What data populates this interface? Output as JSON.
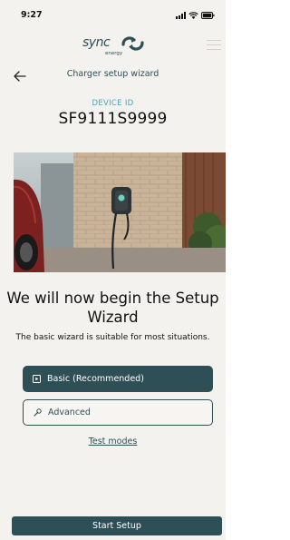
{
  "status_bar": {
    "time": "9:27",
    "icons": [
      "signal-icon",
      "wifi-icon",
      "battery-icon"
    ]
  },
  "brand": {
    "logo_text": "sync",
    "logo_subtext": "energy",
    "accent_color": "#2f4f57",
    "highlight_color": "#4aa3c8"
  },
  "header": {
    "title": "Charger setup wizard",
    "back_icon": "arrow-left-icon",
    "menu_icon": "hamburger-menu-icon"
  },
  "device": {
    "label": "DEVICE ID",
    "id": "SF9111S9999"
  },
  "hero": {
    "image": "wall-mounted EV charger on brick wall beside a car"
  },
  "main": {
    "headline": "We will now begin the Setup Wizard",
    "subtext": "The basic wizard is suitable for most situations.",
    "options": [
      {
        "label": "Basic (Recommended)",
        "icon": "play-square-icon",
        "selected": true
      },
      {
        "label": "Advanced",
        "icon": "wrench-icon",
        "selected": false
      }
    ],
    "test_modes_link": "Test modes"
  },
  "footer": {
    "start_button": "Start Setup"
  }
}
